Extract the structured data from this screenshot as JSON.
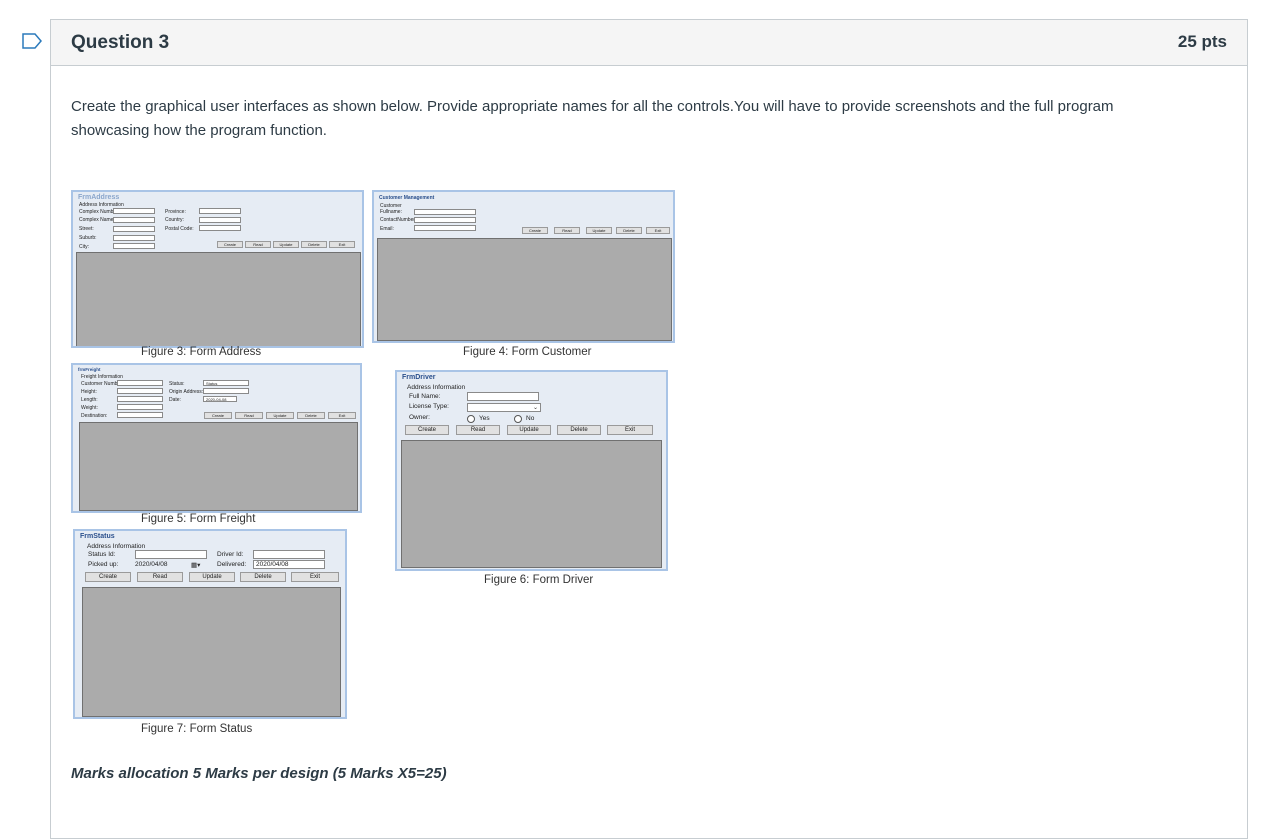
{
  "question": {
    "title": "Question 3",
    "points": "25 pts",
    "body": "Create the graphical user interfaces as shown below. Provide appropriate names for all the controls.You will have to provide screenshots and the full program showcasing how the program function.",
    "marks": "Marks allocation 5 Marks per design (5 Marks X5=25)"
  },
  "buttons": [
    "Create",
    "Read",
    "Update",
    "Delete",
    "Exit"
  ],
  "figures": {
    "address": {
      "caption": "Figure 3: Form Address",
      "title": "FrmAddress",
      "group": "Address Information",
      "labels_left": [
        "Complex Number:",
        "Complex Name:",
        "Street:",
        "Suburb:",
        "City:"
      ],
      "labels_right": [
        "Province:",
        "Country:",
        "Postal Code:"
      ]
    },
    "customer": {
      "caption": "Figure 4: Form Customer",
      "title": "Customer Management",
      "group": "Customer",
      "labels": [
        "Fullname:",
        "ContactNumber:",
        "Email:"
      ]
    },
    "freight": {
      "caption": "Figure 5: Form Freight",
      "title": "frmFreight",
      "group": "Freight Information",
      "labels_left": [
        "Customer Number:",
        "Height:",
        "Length:",
        "Weight:",
        "Destination:"
      ],
      "labels_right": [
        "Status:",
        "Origin Address:",
        "Date:"
      ],
      "status_value": "Status",
      "date_value": "2020-04-08"
    },
    "driver": {
      "caption": "Figure 6: Form Driver",
      "title": "FrmDriver",
      "group": "Address Information",
      "labels": [
        "Full Name:",
        "License Type:",
        "Owner:"
      ],
      "radio_yes": "Yes",
      "radio_no": "No"
    },
    "status": {
      "caption": "Figure 7: Form Status",
      "title": "FrmStatus",
      "group": "Address Information",
      "status_id": "Status Id:",
      "driver_id": "Driver Id:",
      "picked_up": "Picked up:",
      "delivered": "Delivered:",
      "picked_date": "2020/04/08",
      "delivered_date": "2020/04/08"
    }
  }
}
